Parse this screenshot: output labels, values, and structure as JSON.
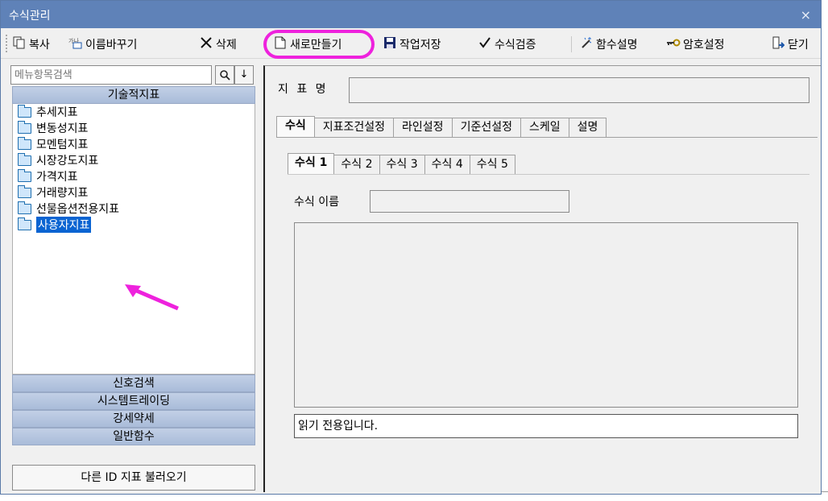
{
  "window": {
    "title": "수식관리",
    "close_glyph": "×"
  },
  "toolbar": {
    "copy": "복사",
    "rename": "이름바꾸기",
    "delete": "삭제",
    "new": "새로만들기",
    "save": "작업저장",
    "verify": "수식검증",
    "func_desc": "함수설명",
    "password": "암호설정",
    "close": "닫기"
  },
  "search": {
    "placeholder": "메뉴항목검색",
    "search_glyph": "🔍",
    "down_glyph": "↓"
  },
  "categories": {
    "technical": "기술적지표",
    "signal": "신호검색",
    "system_trading": "시스템트레이딩",
    "strength": "강세약세",
    "general_func": "일반함수"
  },
  "tree": [
    "추세지표",
    "변동성지표",
    "모멘텀지표",
    "시장강도지표",
    "가격지표",
    "거래량지표",
    "선물옵션전용지표",
    "사용자지표"
  ],
  "load_other_id": "다른 ID 지표 불러오기",
  "form": {
    "indicator_name_label": "지 표 명",
    "formula_name_label": "수식 이름",
    "status_text": "읽기 전용입니다."
  },
  "tabs": [
    "수식",
    "지표조건설정",
    "라인설정",
    "기준선설정",
    "스케일",
    "설명"
  ],
  "subtabs": [
    "수식 1",
    "수식 2",
    "수식 3",
    "수식 4",
    "수식 5"
  ],
  "colors": {
    "highlight": "#ee22dd",
    "selection": "#0a64d2",
    "titlebar": "#5f82b8"
  }
}
